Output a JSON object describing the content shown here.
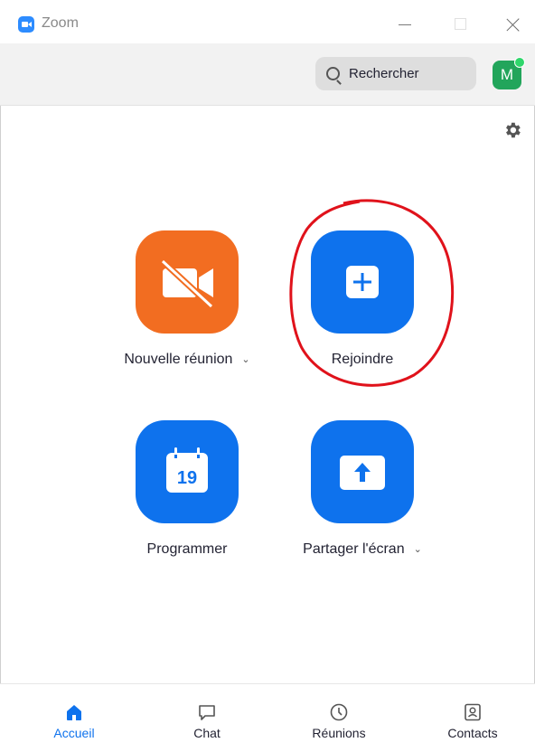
{
  "window": {
    "title": "Zoom",
    "controls": [
      "minimize",
      "maximize",
      "close"
    ]
  },
  "header": {
    "search_placeholder": "Rechercher",
    "avatar_initial": "M",
    "presence_color": "#2fd66b"
  },
  "settings_icon": "gear-icon",
  "tiles": [
    {
      "label": "Nouvelle réunion",
      "icon": "video-off-icon",
      "color": "#f26d21",
      "has_dropdown": true
    },
    {
      "label": "Rejoindre",
      "icon": "plus-icon",
      "color": "#0e72ed",
      "has_dropdown": false,
      "annotation": "circled-in-red"
    },
    {
      "label": "Programmer",
      "icon": "calendar-icon",
      "icon_text": "19",
      "color": "#0e72ed",
      "has_dropdown": false
    },
    {
      "label": "Partager l'écran",
      "icon": "share-up-arrow-icon",
      "color": "#0e72ed",
      "has_dropdown": true
    }
  ],
  "bottom_nav": [
    {
      "label": "Accueil",
      "icon": "home-icon",
      "active": true
    },
    {
      "label": "Chat",
      "icon": "chat-icon",
      "active": false
    },
    {
      "label": "Réunions",
      "icon": "clock-icon",
      "active": false
    },
    {
      "label": "Contacts",
      "icon": "contacts-icon",
      "active": false
    }
  ],
  "colors": {
    "accent": "#0e72ed",
    "orange": "#f26d21",
    "annotation_red": "#e0121b"
  }
}
